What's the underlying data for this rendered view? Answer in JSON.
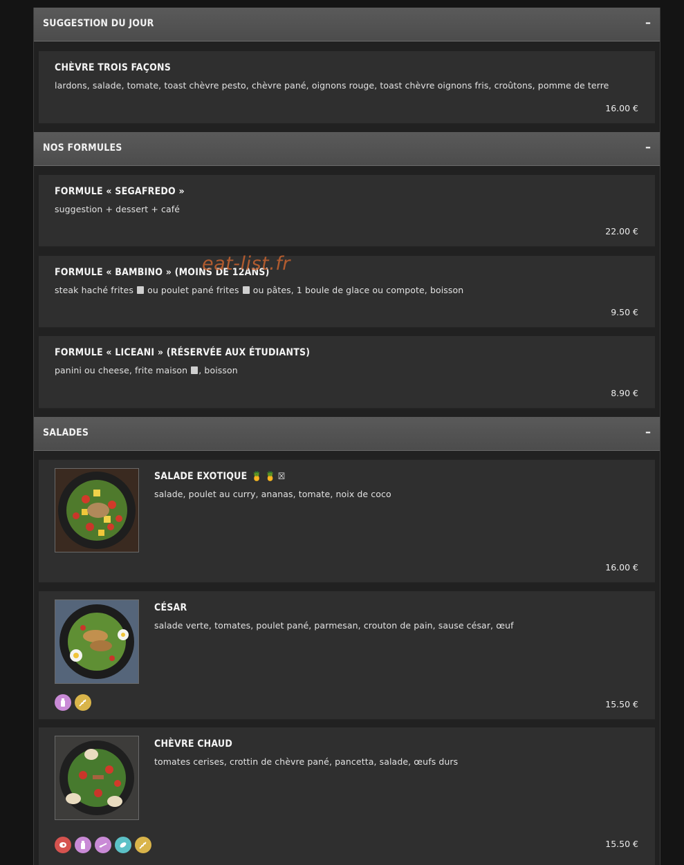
{
  "sections": [
    {
      "title": "Suggestion du jour",
      "toggle": "–",
      "items": [
        {
          "name": "Chèvre trois façons",
          "description": "lardons, salade, tomate, toast chèvre pesto, chèvre pané, oignons rouge, toast chèvre oignons fris, croûtons, pomme de terre",
          "price": "16.00 €"
        }
      ]
    },
    {
      "title": "Nos formules",
      "toggle": "–",
      "items": [
        {
          "name": "Formule « Segafredo »",
          "description": "suggestion + dessert + café",
          "price": "22.00 €"
        },
        {
          "name": "Formule « Bambino » (moins de 12ans)",
          "description_parts": [
            "steak haché frites ",
            " ou poulet pané frites ",
            " ou pâtes, 1 boule de glace ou compote, boisson"
          ],
          "price": "9.50 €"
        },
        {
          "name": "Formule « Liceani » (réservée aux étudiants)",
          "description_parts": [
            "panini ou cheese, frite maison ",
            ", boisson"
          ],
          "price": "8.90 €"
        }
      ]
    },
    {
      "title": "Salades",
      "toggle": "–",
      "items": [
        {
          "name": "Salade exotique",
          "name_icons": "🍍🍍☒",
          "description": "salade, poulet au curry, ananas, tomate, noix de coco",
          "price": "16.00 €",
          "image": "salad-exotic-photo"
        },
        {
          "name": "César",
          "description": "salade verte, tomates, poulet pané, parmesan, crouton de pain, sause césar, œuf",
          "price": "15.50 €",
          "image": "caesar-salad-photo",
          "allergen_icons": [
            {
              "name": "milk-bottle-icon",
              "color": "#c98ad6"
            },
            {
              "name": "wheat-icon",
              "color": "#d9b44a"
            }
          ]
        },
        {
          "name": "Chèvre chaud",
          "description": "tomates cerises, crottin de chèvre pané, pancetta, salade, œufs durs",
          "price": "15.50 €",
          "image": "goat-cheese-salad-photo",
          "allergen_icons": [
            {
              "name": "meat-icon",
              "color": "#d6534f"
            },
            {
              "name": "milk-bottle-icon",
              "color": "#c98ad6"
            },
            {
              "name": "egg-icon",
              "color": "#c98ad6"
            },
            {
              "name": "leaf-icon",
              "color": "#5cc1c7"
            },
            {
              "name": "wheat-icon",
              "color": "#d9b44a"
            }
          ]
        }
      ]
    }
  ],
  "watermark": "eat-list.fr"
}
